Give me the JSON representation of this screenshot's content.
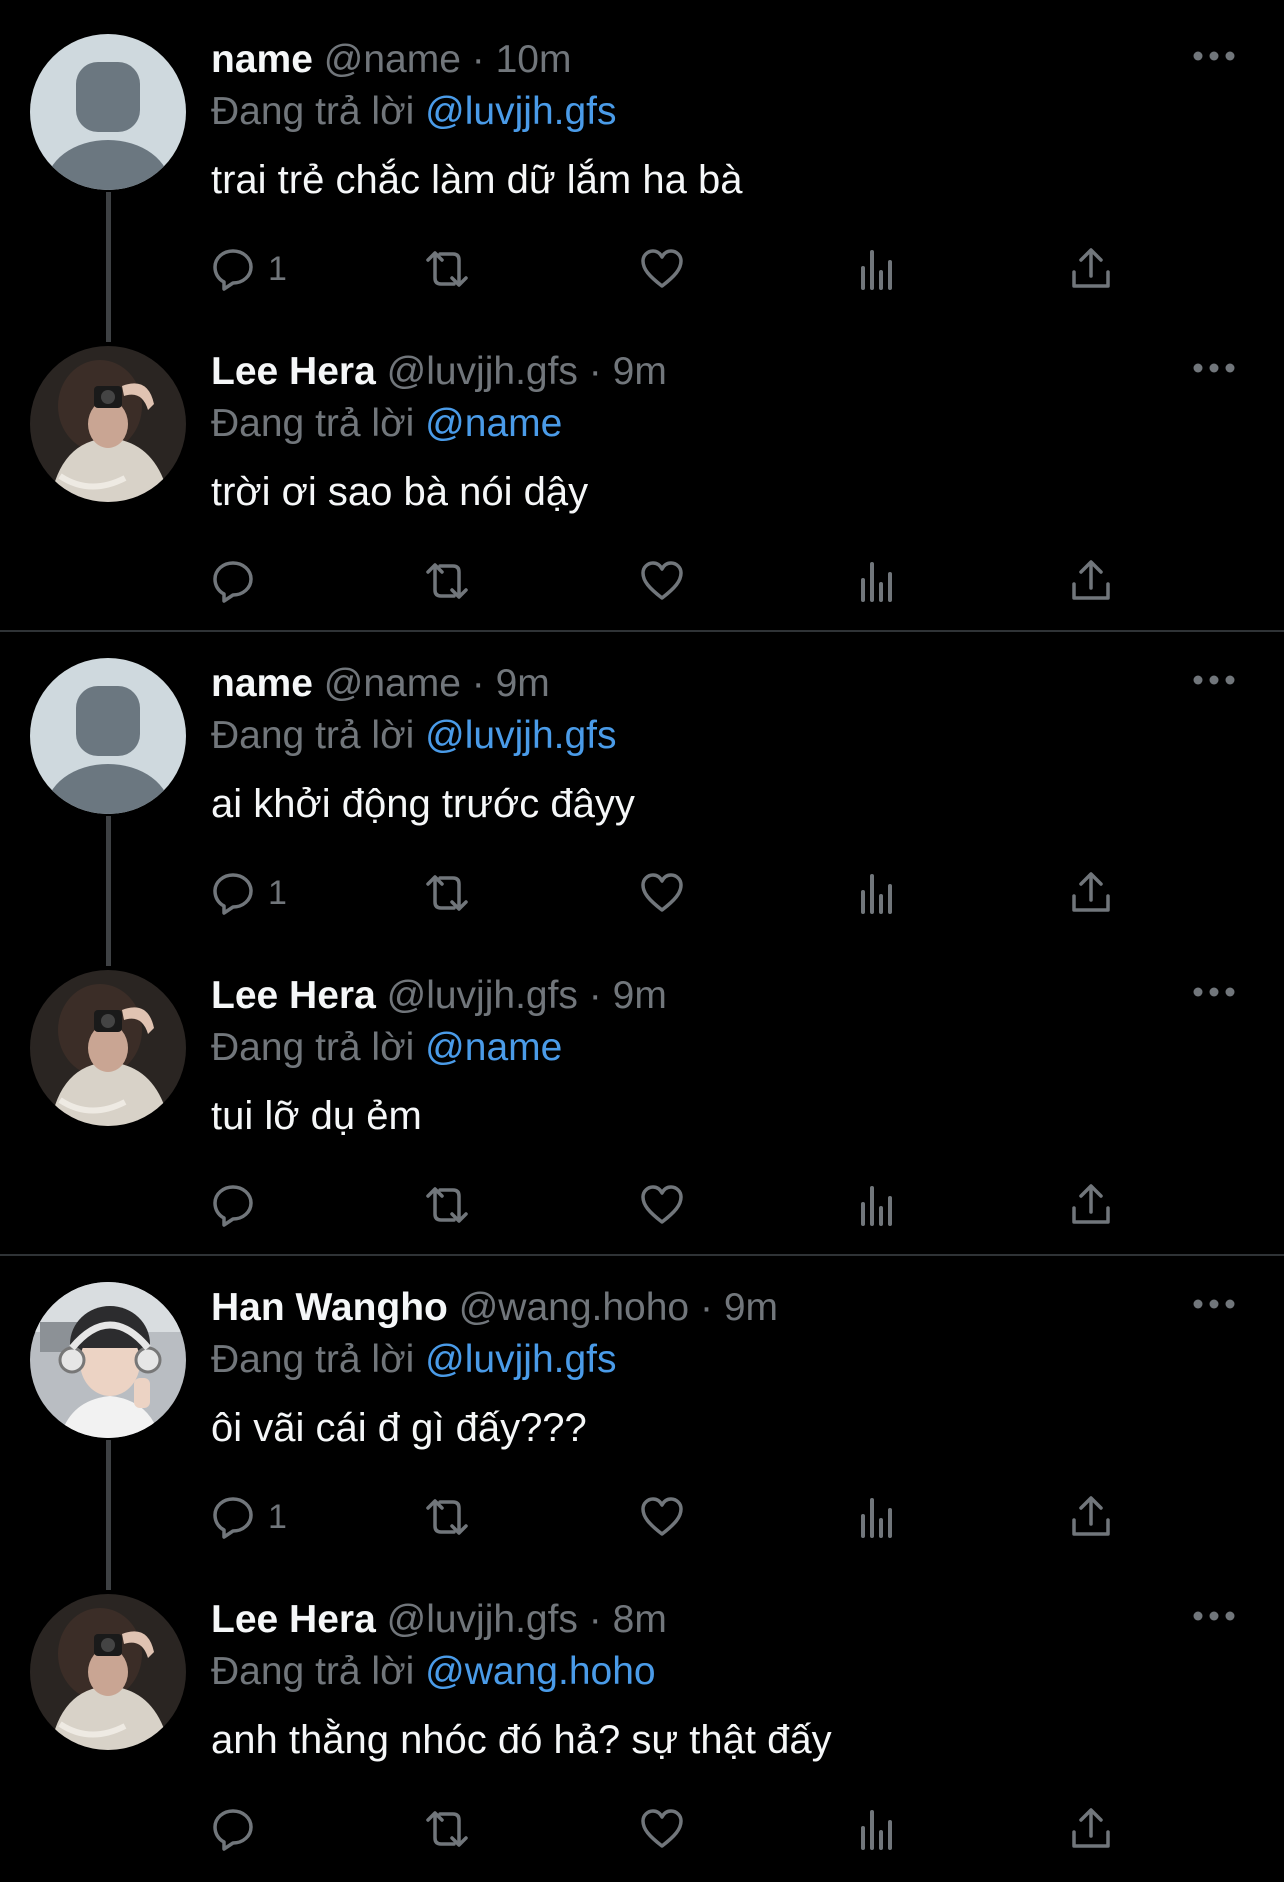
{
  "reply_prefix": "Đang trả lời",
  "threads": [
    {
      "tweets": [
        {
          "name": "name",
          "handle": "@name",
          "dot": "·",
          "time": "10m",
          "reply_to": "@luvjjh.gfs",
          "text": "trai trẻ chắc làm dữ lắm ha bà",
          "reply_count": "1",
          "avatar": "default-avatar"
        },
        {
          "name": "Lee Hera",
          "handle": "@luvjjh.gfs",
          "dot": "·",
          "time": "9m",
          "reply_to": "@name",
          "text": "trời ơi sao bà nói dậy",
          "reply_count": "",
          "avatar": "photo-avatar-girl"
        }
      ]
    },
    {
      "tweets": [
        {
          "name": "name",
          "handle": "@name",
          "dot": "·",
          "time": "9m",
          "reply_to": "@luvjjh.gfs",
          "text": "ai khởi động trước đâyy",
          "reply_count": "1",
          "avatar": "default-avatar"
        },
        {
          "name": "Lee Hera",
          "handle": "@luvjjh.gfs",
          "dot": "·",
          "time": "9m",
          "reply_to": "@name",
          "text": "tui lỡ dụ ẻm",
          "reply_count": "",
          "avatar": "photo-avatar-girl"
        }
      ]
    },
    {
      "tweets": [
        {
          "name": "Han Wangho",
          "handle": "@wang.hoho",
          "dot": "·",
          "time": "9m",
          "reply_to": "@luvjjh.gfs",
          "text": "ôi vãi cái đ gì đấy???",
          "reply_count": "1",
          "avatar": "photo-avatar-boy"
        },
        {
          "name": "Lee Hera",
          "handle": "@luvjjh.gfs",
          "dot": "·",
          "time": "8m",
          "reply_to": "@wang.hoho",
          "text": "anh thằng nhóc đó hả? sự thật đấy",
          "reply_count": "",
          "avatar": "photo-avatar-girl"
        }
      ]
    }
  ],
  "colors": {
    "background": "#000000",
    "mention": "#4a9be8",
    "muted": "#71767b",
    "divider": "#2f3336"
  }
}
